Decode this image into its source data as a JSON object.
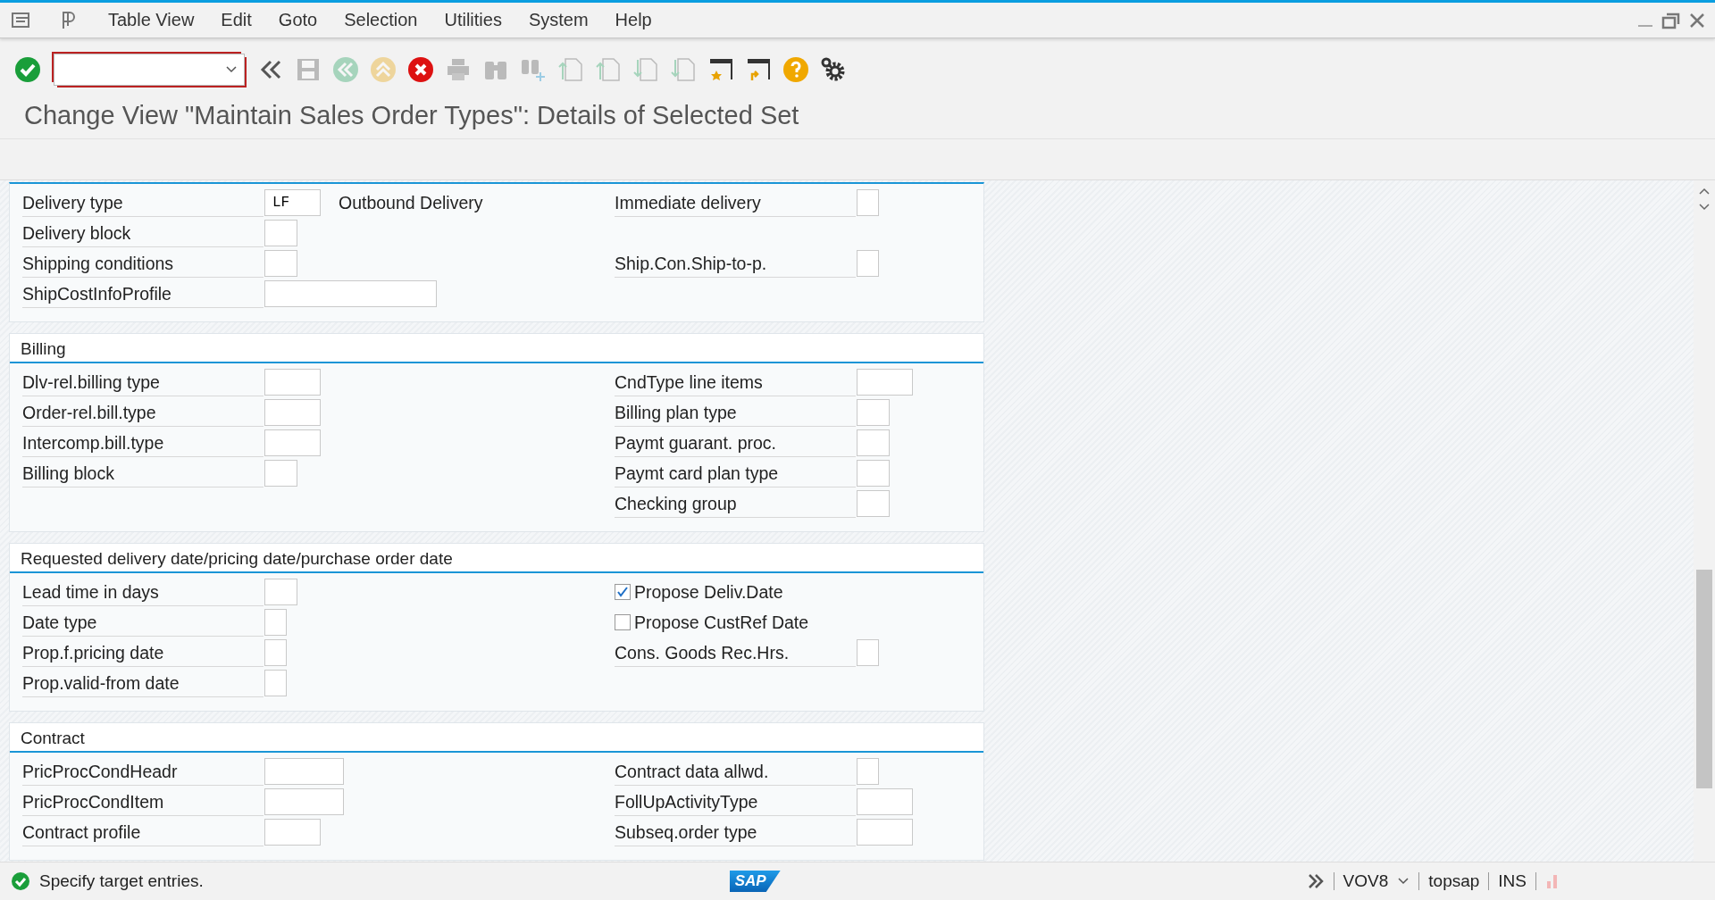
{
  "menu": [
    "Table View",
    "Edit",
    "Goto",
    "Selection",
    "Utilities",
    "System",
    "Help"
  ],
  "toolbar": [
    {
      "kind": "enter",
      "disabled": false
    },
    {
      "kind": "command-field"
    },
    {
      "kind": "collapse",
      "disabled": false
    },
    {
      "kind": "save",
      "disabled": true
    },
    {
      "kind": "back",
      "disabled": true
    },
    {
      "kind": "exit",
      "disabled": true
    },
    {
      "kind": "cancel",
      "disabled": false
    },
    {
      "kind": "print",
      "disabled": true
    },
    {
      "kind": "find",
      "disabled": true
    },
    {
      "kind": "find-next",
      "disabled": true
    },
    {
      "kind": "first-page",
      "disabled": true
    },
    {
      "kind": "previous-page",
      "disabled": true
    },
    {
      "kind": "next-page",
      "disabled": true
    },
    {
      "kind": "last-page",
      "disabled": true
    },
    {
      "kind": "new-session",
      "disabled": false
    },
    {
      "kind": "shortcut",
      "disabled": false
    },
    {
      "kind": "help",
      "disabled": false
    },
    {
      "kind": "settings",
      "disabled": false
    }
  ],
  "title": "Change View \"Maintain Sales Order Types\": Details of Selected Set",
  "sections": [
    {
      "rows": [
        {
          "left": {
            "kind": "medium",
            "label": "Delivery type",
            "value": "LF",
            "description": "Outbound Delivery"
          },
          "right": {
            "kind": "tiny",
            "label": "Immediate delivery"
          }
        },
        {
          "left": {
            "kind": "small",
            "label": "Delivery block"
          }
        },
        {
          "left": {
            "kind": "small",
            "label": "Shipping conditions"
          },
          "right": {
            "kind": "tiny",
            "label": "Ship.Con.Ship-to-p."
          }
        },
        {
          "left": {
            "kind": "wide",
            "label": "ShipCostInfoProfile"
          }
        }
      ]
    },
    {
      "title": "Billing",
      "rows": [
        {
          "left": {
            "kind": "medium",
            "label": "Dlv-rel.billing type"
          },
          "right": {
            "kind": "medium",
            "label": "CndType line items"
          }
        },
        {
          "left": {
            "kind": "medium",
            "label": "Order-rel.bill.type"
          },
          "right": {
            "kind": "small",
            "label": "Billing plan type"
          }
        },
        {
          "left": {
            "kind": "medium",
            "label": "Intercomp.bill.type"
          },
          "right": {
            "kind": "small",
            "label": "Paymt guarant. proc."
          }
        },
        {
          "left": {
            "kind": "small",
            "label": "Billing block"
          },
          "right": {
            "kind": "small",
            "label": "Paymt card plan type"
          }
        },
        {
          "right": {
            "kind": "small",
            "label": "Checking group"
          }
        }
      ]
    },
    {
      "title": "Requested delivery date/pricing date/purchase order date",
      "rows": [
        {
          "left": {
            "kind": "small",
            "label": "Lead time in days"
          },
          "right": {
            "kind": "checkbox",
            "label": "Propose Deliv.Date",
            "checked": true
          }
        },
        {
          "left": {
            "kind": "tiny",
            "label": "Date type"
          },
          "right": {
            "kind": "checkbox",
            "label": "Propose CustRef Date",
            "checked": false
          }
        },
        {
          "left": {
            "kind": "tiny",
            "label": "Prop.f.pricing date"
          },
          "right": {
            "kind": "tiny",
            "label": "Cons. Goods Rec.Hrs."
          }
        },
        {
          "left": {
            "kind": "tiny",
            "label": "Prop.valid-from date"
          }
        }
      ]
    },
    {
      "title": "Contract",
      "rows": [
        {
          "left": {
            "kind": "large",
            "label": "PricProcCondHeadr"
          },
          "right": {
            "kind": "tiny",
            "label": "Contract data allwd."
          }
        },
        {
          "left": {
            "kind": "large",
            "label": "PricProcCondItem"
          },
          "right": {
            "kind": "medium",
            "label": "FollUpActivityType"
          }
        },
        {
          "left": {
            "kind": "medium",
            "label": "Contract profile"
          },
          "right": {
            "kind": "medium",
            "label": "Subseq.order type"
          }
        }
      ]
    }
  ],
  "status_bar": {
    "kind": "success",
    "message": "Specify target entries.",
    "logo": "SAP",
    "system": "VOV8",
    "user": "topsap",
    "mode": "INS"
  }
}
